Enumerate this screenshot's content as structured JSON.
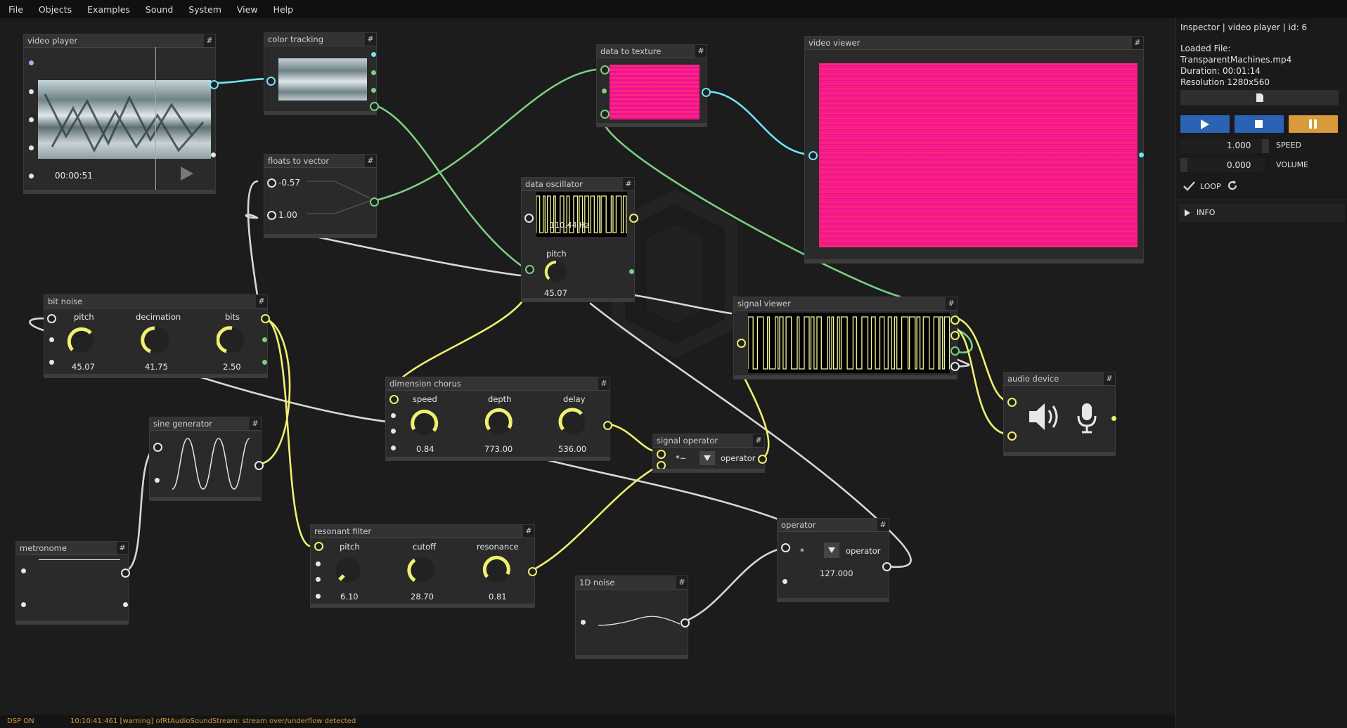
{
  "menubar": {
    "items": [
      "File",
      "Objects",
      "Examples",
      "Sound",
      "System",
      "View",
      "Help"
    ]
  },
  "nodes": {
    "video_player": {
      "title": "video player",
      "hash": "#",
      "time": "00:00:51"
    },
    "color_tracking": {
      "title": "color tracking",
      "hash": "#"
    },
    "floats_to_vector": {
      "title": "floats to vector",
      "hash": "#",
      "val1": "-0.57",
      "val2": "1.00"
    },
    "data_to_texture": {
      "title": "data to texture",
      "hash": "#"
    },
    "video_viewer": {
      "title": "video viewer",
      "hash": "#"
    },
    "data_oscillator": {
      "title": "data oscillator",
      "hash": "#",
      "freq": "110.44 Hz",
      "knob_label": "pitch",
      "knob_value": "45.07"
    },
    "bit_noise": {
      "title": "bit noise",
      "hash": "#",
      "knobs": [
        {
          "label": "pitch",
          "value": "45.07"
        },
        {
          "label": "decimation",
          "value": "41.75"
        },
        {
          "label": "bits",
          "value": "2.50"
        }
      ]
    },
    "signal_viewer": {
      "title": "signal viewer",
      "hash": "#"
    },
    "audio_device": {
      "title": "audio device",
      "hash": "#"
    },
    "dimension_chorus": {
      "title": "dimension chorus",
      "hash": "#",
      "knobs": [
        {
          "label": "speed",
          "value": "0.84"
        },
        {
          "label": "depth",
          "value": "773.00"
        },
        {
          "label": "delay",
          "value": "536.00"
        }
      ]
    },
    "sine_generator": {
      "title": "sine generator",
      "hash": "#"
    },
    "signal_operator": {
      "title": "signal operator",
      "hash": "#",
      "op": "*~",
      "label": "operator"
    },
    "metronome": {
      "title": "metronome",
      "hash": "#"
    },
    "resonant_filter": {
      "title": "resonant filter",
      "hash": "#",
      "knobs": [
        {
          "label": "pitch",
          "value": "6.10"
        },
        {
          "label": "cutoff",
          "value": "28.70"
        },
        {
          "label": "resonance",
          "value": "0.81"
        }
      ]
    },
    "operator": {
      "title": "operator",
      "hash": "#",
      "op": "*",
      "label": "operator",
      "value": "127.000"
    },
    "noise_1d": {
      "title": "1D noise",
      "hash": "#"
    }
  },
  "inspector": {
    "title": "Inspector | video player | id: 6",
    "loaded_file_label": "Loaded File:",
    "filename": "TransparentMachines.mp4",
    "duration": "Duration:  00:01:14",
    "resolution": "Resolution 1280x560",
    "speed_value": "1.000",
    "speed_label": "SPEED",
    "volume_value": "0.000",
    "volume_label": "VOLUME",
    "loop_label": "LOOP",
    "info_label": "INFO",
    "colors": {
      "play": "#2b62b4",
      "stop": "#2b62b4",
      "pause": "#d89a3a"
    }
  },
  "status": {
    "dsp": "DSP ON",
    "message": "10:10:41:461 [warning] ofRtAudioSoundStream: stream over/underflow detected"
  },
  "colors": {
    "audio": "#f0f070",
    "data": "#7ccf82",
    "texture": "#6fe6f0",
    "number": "#e6e6e6",
    "bg": "#1c1c1c"
  }
}
